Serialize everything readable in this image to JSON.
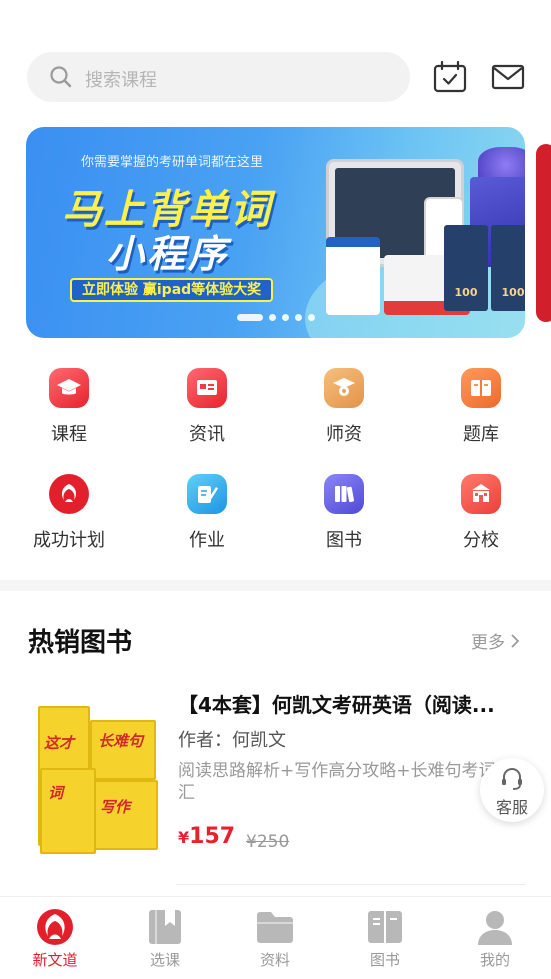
{
  "header": {
    "search_placeholder": "搜索课程",
    "icons": [
      "calendar-check-icon",
      "mail-icon"
    ]
  },
  "banner": {
    "subtitle": "你需要掌握的考研单词都在这里",
    "title_line1": "马上背单词",
    "title_line2": "小程序",
    "cta": "立即体验 赢ipad等体验大奖",
    "bag_label": "100",
    "slide_count": 5,
    "active_slide": 1
  },
  "categories": [
    {
      "label": "课程",
      "icon": "graduation-cap-icon",
      "color": "#f03c48"
    },
    {
      "label": "资讯",
      "icon": "news-icon",
      "color": "#f03c48"
    },
    {
      "label": "师资",
      "icon": "teacher-icon",
      "color": "#e9a25b"
    },
    {
      "label": "题库",
      "icon": "question-bank-icon",
      "color": "#f27a3a"
    },
    {
      "label": "成功计划",
      "icon": "phoenix-logo-icon",
      "color": "#e2202c"
    },
    {
      "label": "作业",
      "icon": "homework-icon",
      "color": "#2fa8ec"
    },
    {
      "label": "图书",
      "icon": "books-icon",
      "color": "#5b5be0"
    },
    {
      "label": "分校",
      "icon": "school-icon",
      "color": "#f05a4a"
    }
  ],
  "hot_books": {
    "title": "热销图书",
    "more": "更多",
    "items": [
      {
        "title": "【4本套】何凯文考研英语（阅读...",
        "author": "作者：何凯文",
        "desc": "阅读思路解析+写作高分攻略+长难句考词汇",
        "currency": "¥",
        "price": "157",
        "original_price": "¥250"
      }
    ]
  },
  "customer_service": "客服",
  "tabbar": [
    {
      "label": "新文道",
      "icon": "phoenix-logo-icon",
      "active": true
    },
    {
      "label": "选课",
      "icon": "bookmark-book-icon",
      "active": false
    },
    {
      "label": "资料",
      "icon": "folder-icon",
      "active": false
    },
    {
      "label": "图书",
      "icon": "open-book-icon",
      "active": false
    },
    {
      "label": "我的",
      "icon": "user-icon",
      "active": false
    }
  ],
  "colors": {
    "brand_red": "#e2202c",
    "banner_blue": "#3a8ff1",
    "muted": "#999999"
  }
}
